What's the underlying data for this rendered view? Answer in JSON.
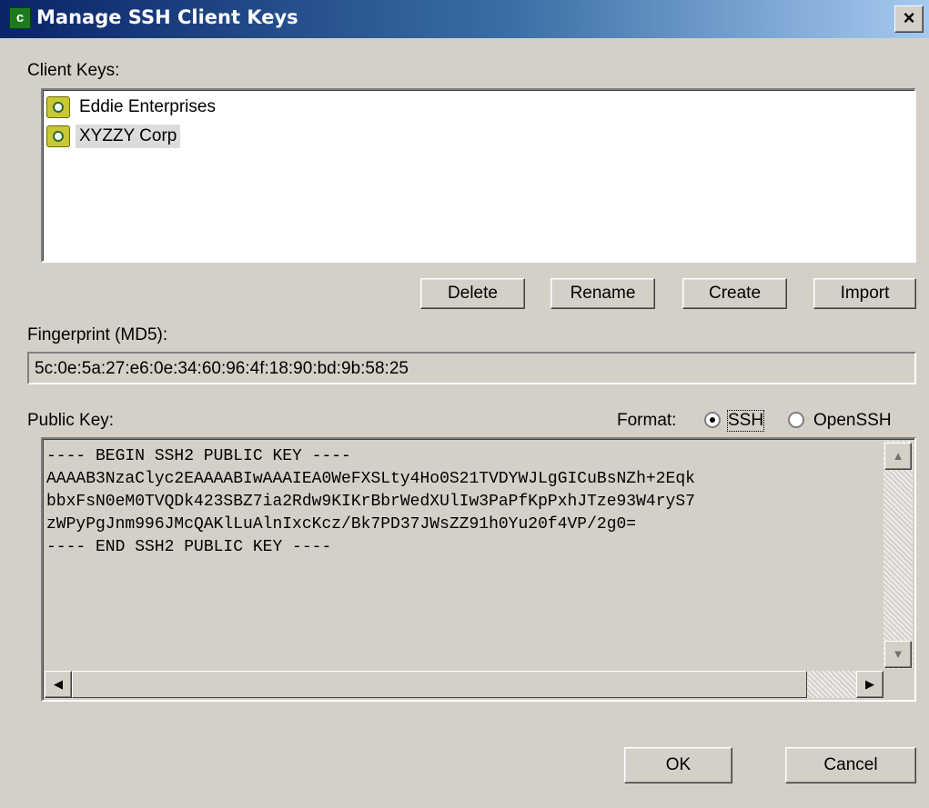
{
  "window": {
    "title": "Manage SSH Client Keys",
    "close_label": "×",
    "app_icon_glyph": "c"
  },
  "client_keys": {
    "label": "Client Keys:",
    "items": [
      {
        "label": "Eddie Enterprises",
        "icon": "key-icon",
        "selected": false
      },
      {
        "label": "XYZZY Corp",
        "icon": "key-icon",
        "selected": true
      }
    ]
  },
  "buttons": {
    "delete": "Delete",
    "rename": "Rename",
    "create": "Create",
    "import": "Import",
    "ok": "OK",
    "cancel": "Cancel"
  },
  "fingerprint": {
    "label": "Fingerprint (MD5):",
    "value": "5c:0e:5a:27:e6:0e:34:60:96:4f:18:90:bd:9b:58:25"
  },
  "public_key": {
    "label": "Public Key:",
    "format_label": "Format:",
    "format_options": [
      "SSH",
      "OpenSSH"
    ],
    "format_selected": "SSH",
    "lines": [
      "---- BEGIN SSH2 PUBLIC KEY ----",
      "AAAAB3NzaClyc2EAAAABIwAAAIEA0WeFXSLty4Ho0S21TVDYWJLgGICuBsNZh+2Eqk",
      "bbxFsN0eM0TVQDk423SBZ7ia2Rdw9KIKrBbrWedXUlIw3PaPfKpPxhJTze93W4ryS7",
      "zWPyPgJnm996JMcQAKlLuAlnIxcKcz/Bk7PD37JWsZZ91h0Yu20f4VP/2g0=",
      "---- END SSH2 PUBLIC KEY ----"
    ]
  },
  "scrollbar": {
    "up": "▲",
    "down": "▼",
    "left": "◀",
    "right": "▶"
  }
}
